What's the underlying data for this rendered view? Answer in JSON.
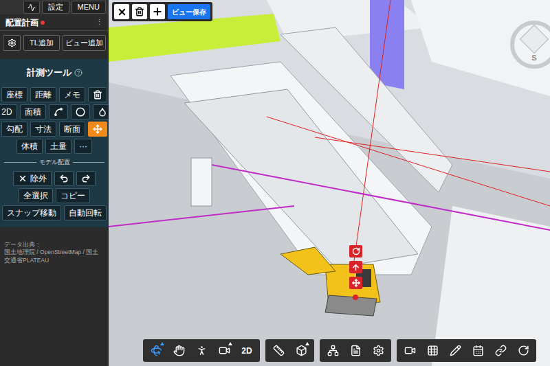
{
  "header": {
    "settings": "設定",
    "menu": "MENU"
  },
  "project": {
    "name": "配置計画",
    "modified": true,
    "menu": "⋮"
  },
  "panel_buttons": [
    "TL追加",
    "ビュー追加"
  ],
  "tools": {
    "title": "計測ツール",
    "rows": [
      [
        {
          "kind": "text",
          "label": "座標",
          "selected": false
        },
        {
          "kind": "text",
          "label": "距離",
          "selected": false
        },
        {
          "kind": "text",
          "label": "メモ",
          "selected": false
        },
        {
          "kind": "icon",
          "selected": false
        }
      ],
      [
        {
          "kind": "text",
          "label": "2D",
          "selected": false
        },
        {
          "kind": "text",
          "label": "面積",
          "selected": false
        },
        {
          "kind": "icon",
          "selected": false
        },
        {
          "kind": "icon",
          "selected": false
        },
        {
          "kind": "icon",
          "selected": false
        }
      ],
      [
        {
          "kind": "text",
          "label": "勾配",
          "selected": false
        },
        {
          "kind": "text",
          "label": "寸法",
          "selected": false
        },
        {
          "kind": "text",
          "label": "断面",
          "selected": false
        },
        {
          "kind": "icon",
          "selected": true
        }
      ],
      [
        {
          "kind": "text",
          "label": "体積",
          "selected": false
        },
        {
          "kind": "text",
          "label": "土量",
          "selected": false
        },
        {
          "kind": "text",
          "label": "···",
          "selected": false
        }
      ]
    ]
  },
  "placement": {
    "title": "モデル配置",
    "rows": [
      [
        {
          "kind": "icon-text",
          "label": "除外"
        },
        {
          "kind": "icon"
        },
        {
          "kind": "icon"
        }
      ],
      [
        {
          "kind": "text",
          "label": "全選択"
        },
        {
          "kind": "text",
          "label": "コピー"
        }
      ],
      [
        {
          "kind": "text",
          "label": "スナップ移動"
        },
        {
          "kind": "text",
          "label": "自動回転"
        }
      ]
    ]
  },
  "attribution": [
    "データ出典：",
    "国土地理院 / OpenStreetMap / 国土交通省PLATEAU"
  ],
  "view_toolbar": {
    "save": "ビュー保存"
  },
  "compass": {
    "label": "S"
  },
  "bottom_toolbar": {
    "groups": [
      [
        {
          "kind": "icon",
          "selected": true,
          "dropdown": true
        },
        {
          "kind": "icon",
          "selected": false,
          "dropdown": false
        },
        {
          "kind": "icon",
          "selected": false,
          "dropdown": false
        },
        {
          "kind": "icon",
          "selected": false,
          "dropdown": true
        },
        {
          "kind": "text",
          "label": "2D",
          "selected": false,
          "dropdown": false
        }
      ],
      [
        {
          "kind": "icon",
          "selected": false,
          "dropdown": false
        },
        {
          "kind": "icon",
          "selected": false,
          "dropdown": true
        }
      ],
      [
        {
          "kind": "icon",
          "selected": false,
          "dropdown": false
        },
        {
          "kind": "icon",
          "selected": false,
          "dropdown": false
        },
        {
          "kind": "icon",
          "selected": false,
          "dropdown": false
        }
      ],
      [
        {
          "kind": "icon",
          "selected": false,
          "dropdown": false
        },
        {
          "kind": "icon",
          "selected": false,
          "dropdown": false
        },
        {
          "kind": "icon",
          "selected": false,
          "dropdown": false
        },
        {
          "kind": "icon",
          "selected": false,
          "dropdown": false
        },
        {
          "kind": "icon",
          "selected": false,
          "dropdown": false
        },
        {
          "kind": "icon",
          "selected": false,
          "dropdown": false
        }
      ]
    ]
  }
}
